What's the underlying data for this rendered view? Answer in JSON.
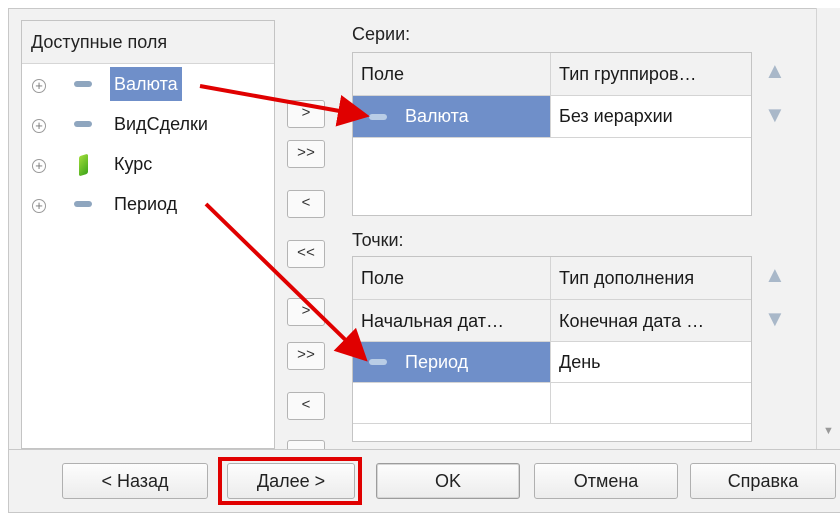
{
  "available": {
    "title": "Доступные поля",
    "items": [
      {
        "label": "Валюта",
        "icon": "dimension-icon",
        "selected": true
      },
      {
        "label": "ВидСделки",
        "icon": "dimension-icon",
        "selected": false
      },
      {
        "label": "Курс",
        "icon": "resource-icon",
        "selected": false
      },
      {
        "label": "Период",
        "icon": "dimension-icon",
        "selected": false
      }
    ]
  },
  "move_buttons": {
    "add": ">",
    "add_all": ">>",
    "remove": "<",
    "remove_all": "<<"
  },
  "series": {
    "caption": "Серии:",
    "col_field": "Поле",
    "col_type": "Тип группиров…",
    "rows": [
      {
        "field": "Валюта",
        "type": "Без иерархии"
      }
    ]
  },
  "points": {
    "caption": "Точки:",
    "col_field": "Поле",
    "col_type": "Тип дополнения",
    "sub_field": "Начальная дат…",
    "sub_type": "Конечная дата …",
    "rows": [
      {
        "field": "Период",
        "type": "День"
      }
    ]
  },
  "footer": {
    "back": "< Назад",
    "next": "Далее >",
    "ok": "OK",
    "cancel": "Отмена",
    "help": "Справка"
  },
  "colors": {
    "selection": "#6f8fc9",
    "annotation": "#e00000"
  }
}
